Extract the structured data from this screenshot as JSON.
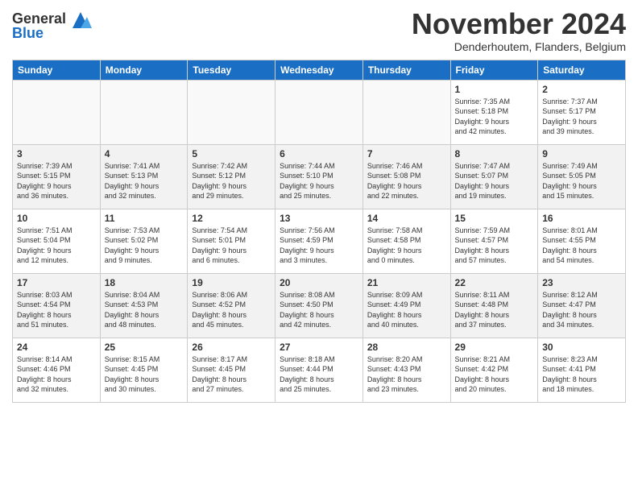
{
  "logo": {
    "general": "General",
    "blue": "Blue"
  },
  "title": "November 2024",
  "location": "Denderhoutem, Flanders, Belgium",
  "headers": [
    "Sunday",
    "Monday",
    "Tuesday",
    "Wednesday",
    "Thursday",
    "Friday",
    "Saturday"
  ],
  "weeks": [
    [
      {
        "day": "",
        "info": ""
      },
      {
        "day": "",
        "info": ""
      },
      {
        "day": "",
        "info": ""
      },
      {
        "day": "",
        "info": ""
      },
      {
        "day": "",
        "info": ""
      },
      {
        "day": "1",
        "info": "Sunrise: 7:35 AM\nSunset: 5:18 PM\nDaylight: 9 hours\nand 42 minutes."
      },
      {
        "day": "2",
        "info": "Sunrise: 7:37 AM\nSunset: 5:17 PM\nDaylight: 9 hours\nand 39 minutes."
      }
    ],
    [
      {
        "day": "3",
        "info": "Sunrise: 7:39 AM\nSunset: 5:15 PM\nDaylight: 9 hours\nand 36 minutes."
      },
      {
        "day": "4",
        "info": "Sunrise: 7:41 AM\nSunset: 5:13 PM\nDaylight: 9 hours\nand 32 minutes."
      },
      {
        "day": "5",
        "info": "Sunrise: 7:42 AM\nSunset: 5:12 PM\nDaylight: 9 hours\nand 29 minutes."
      },
      {
        "day": "6",
        "info": "Sunrise: 7:44 AM\nSunset: 5:10 PM\nDaylight: 9 hours\nand 25 minutes."
      },
      {
        "day": "7",
        "info": "Sunrise: 7:46 AM\nSunset: 5:08 PM\nDaylight: 9 hours\nand 22 minutes."
      },
      {
        "day": "8",
        "info": "Sunrise: 7:47 AM\nSunset: 5:07 PM\nDaylight: 9 hours\nand 19 minutes."
      },
      {
        "day": "9",
        "info": "Sunrise: 7:49 AM\nSunset: 5:05 PM\nDaylight: 9 hours\nand 15 minutes."
      }
    ],
    [
      {
        "day": "10",
        "info": "Sunrise: 7:51 AM\nSunset: 5:04 PM\nDaylight: 9 hours\nand 12 minutes."
      },
      {
        "day": "11",
        "info": "Sunrise: 7:53 AM\nSunset: 5:02 PM\nDaylight: 9 hours\nand 9 minutes."
      },
      {
        "day": "12",
        "info": "Sunrise: 7:54 AM\nSunset: 5:01 PM\nDaylight: 9 hours\nand 6 minutes."
      },
      {
        "day": "13",
        "info": "Sunrise: 7:56 AM\nSunset: 4:59 PM\nDaylight: 9 hours\nand 3 minutes."
      },
      {
        "day": "14",
        "info": "Sunrise: 7:58 AM\nSunset: 4:58 PM\nDaylight: 9 hours\nand 0 minutes."
      },
      {
        "day": "15",
        "info": "Sunrise: 7:59 AM\nSunset: 4:57 PM\nDaylight: 8 hours\nand 57 minutes."
      },
      {
        "day": "16",
        "info": "Sunrise: 8:01 AM\nSunset: 4:55 PM\nDaylight: 8 hours\nand 54 minutes."
      }
    ],
    [
      {
        "day": "17",
        "info": "Sunrise: 8:03 AM\nSunset: 4:54 PM\nDaylight: 8 hours\nand 51 minutes."
      },
      {
        "day": "18",
        "info": "Sunrise: 8:04 AM\nSunset: 4:53 PM\nDaylight: 8 hours\nand 48 minutes."
      },
      {
        "day": "19",
        "info": "Sunrise: 8:06 AM\nSunset: 4:52 PM\nDaylight: 8 hours\nand 45 minutes."
      },
      {
        "day": "20",
        "info": "Sunrise: 8:08 AM\nSunset: 4:50 PM\nDaylight: 8 hours\nand 42 minutes."
      },
      {
        "day": "21",
        "info": "Sunrise: 8:09 AM\nSunset: 4:49 PM\nDaylight: 8 hours\nand 40 minutes."
      },
      {
        "day": "22",
        "info": "Sunrise: 8:11 AM\nSunset: 4:48 PM\nDaylight: 8 hours\nand 37 minutes."
      },
      {
        "day": "23",
        "info": "Sunrise: 8:12 AM\nSunset: 4:47 PM\nDaylight: 8 hours\nand 34 minutes."
      }
    ],
    [
      {
        "day": "24",
        "info": "Sunrise: 8:14 AM\nSunset: 4:46 PM\nDaylight: 8 hours\nand 32 minutes."
      },
      {
        "day": "25",
        "info": "Sunrise: 8:15 AM\nSunset: 4:45 PM\nDaylight: 8 hours\nand 30 minutes."
      },
      {
        "day": "26",
        "info": "Sunrise: 8:17 AM\nSunset: 4:45 PM\nDaylight: 8 hours\nand 27 minutes."
      },
      {
        "day": "27",
        "info": "Sunrise: 8:18 AM\nSunset: 4:44 PM\nDaylight: 8 hours\nand 25 minutes."
      },
      {
        "day": "28",
        "info": "Sunrise: 8:20 AM\nSunset: 4:43 PM\nDaylight: 8 hours\nand 23 minutes."
      },
      {
        "day": "29",
        "info": "Sunrise: 8:21 AM\nSunset: 4:42 PM\nDaylight: 8 hours\nand 20 minutes."
      },
      {
        "day": "30",
        "info": "Sunrise: 8:23 AM\nSunset: 4:41 PM\nDaylight: 8 hours\nand 18 minutes."
      }
    ]
  ]
}
